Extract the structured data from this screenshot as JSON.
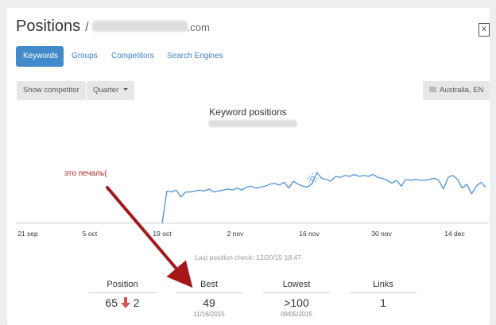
{
  "header": {
    "title": "Positions",
    "slash": "/",
    "domain_suffix": ".com",
    "export_icon": "excel-icon",
    "export_glyph": "x"
  },
  "tabs": [
    {
      "label": "Keywords",
      "active": true
    },
    {
      "label": "Groups",
      "active": false
    },
    {
      "label": "Competitors",
      "active": false
    },
    {
      "label": "Search Engines",
      "active": false
    }
  ],
  "controls": {
    "show_competitor": "Show competitor",
    "period": "Quarter",
    "region": "Australia, EN"
  },
  "chart_data": {
    "type": "line",
    "title": "Keyword positions",
    "x_tick_labels": [
      "21 sep",
      "5 oct",
      "19 oct",
      "2 nov",
      "16 nov",
      "30 nov",
      "14 dec"
    ],
    "series": [
      {
        "values": [
          0,
          33,
          32,
          34,
          27,
          32,
          32,
          33,
          34,
          33,
          35,
          32,
          33,
          34,
          35,
          34,
          36,
          34,
          37,
          38,
          36,
          37,
          38,
          40,
          41,
          39,
          42,
          36,
          43,
          40,
          38,
          37,
          41,
          52,
          46,
          45,
          43,
          48,
          47,
          49,
          48,
          50,
          48,
          49,
          48,
          50,
          47,
          46,
          44,
          41,
          44,
          38,
          45,
          44,
          45,
          44,
          44,
          45,
          46,
          44,
          35,
          47,
          49,
          45,
          36,
          40,
          30,
          38,
          42,
          37
        ]
      }
    ]
  },
  "annotation": "это печаль(",
  "last_check": "Last position check: 12/20/15 18:47",
  "stats": {
    "position": {
      "label": "Position",
      "value": "65",
      "change": "2"
    },
    "best": {
      "label": "Best",
      "value": "49",
      "date": "11/16/2015"
    },
    "lowest": {
      "label": "Lowest",
      "value": ">100",
      "date": "09/05/2015"
    },
    "links": {
      "label": "Links",
      "value": "1"
    }
  },
  "colors": {
    "accent": "#428bca",
    "line": "#4a90d9",
    "arrow": "#a5171b",
    "down": "#d9534f"
  }
}
